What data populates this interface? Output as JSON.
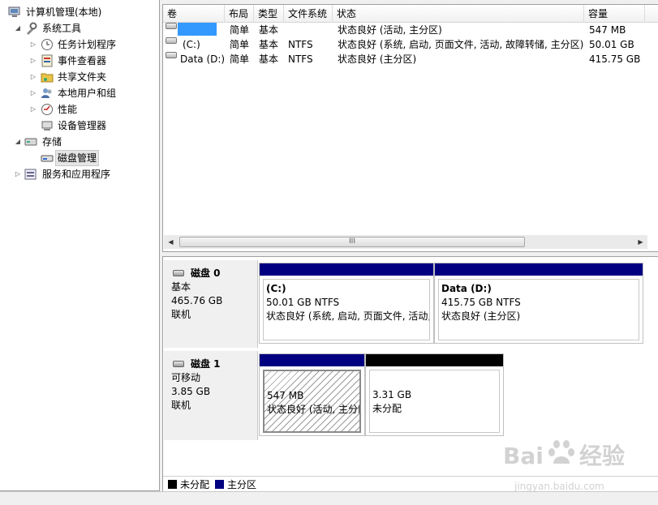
{
  "tree": {
    "items": [
      {
        "label": "计算机管理(本地)",
        "expander": "",
        "icon": "computer-management-icon"
      },
      {
        "label": "系统工具",
        "expander": "◢",
        "icon": "tools-icon"
      },
      {
        "label": "任务计划程序",
        "expander": "▷",
        "icon": "clock-icon"
      },
      {
        "label": "事件查看器",
        "expander": "▷",
        "icon": "event-viewer-icon"
      },
      {
        "label": "共享文件夹",
        "expander": "▷",
        "icon": "shared-folder-icon"
      },
      {
        "label": "本地用户和组",
        "expander": "▷",
        "icon": "users-icon"
      },
      {
        "label": "性能",
        "expander": "▷",
        "icon": "performance-icon"
      },
      {
        "label": "设备管理器",
        "expander": "",
        "icon": "device-manager-icon"
      },
      {
        "label": "存储",
        "expander": "◢",
        "icon": "storage-icon"
      },
      {
        "label": "磁盘管理",
        "expander": "",
        "icon": "disk-management-icon"
      },
      {
        "label": "服务和应用程序",
        "expander": "▷",
        "icon": "services-icon"
      }
    ]
  },
  "volumes": {
    "columns": [
      "卷",
      "布局",
      "类型",
      "文件系统",
      "状态",
      "容量"
    ],
    "rows": [
      {
        "name": "",
        "layout": "简单",
        "type": "基本",
        "fs": "",
        "status": "状态良好 (活动, 主分区)",
        "capacity": "547 MB"
      },
      {
        "name": "(C:)",
        "layout": "简单",
        "type": "基本",
        "fs": "NTFS",
        "status": "状态良好 (系统, 启动, 页面文件, 活动, 故障转储, 主分区)",
        "capacity": "50.01 GB"
      },
      {
        "name": "Data (D:)",
        "layout": "简单",
        "type": "基本",
        "fs": "NTFS",
        "status": "状态良好 (主分区)",
        "capacity": "415.75 GB"
      }
    ],
    "scroll_grip": "III"
  },
  "disks": [
    {
      "name": "磁盘 0",
      "type": "基本",
      "size": "465.76 GB",
      "state": "联机",
      "partitions": [
        {
          "title": "(C:)",
          "size": "50.01 GB NTFS",
          "status": "状态良好 (系统, 启动, 页面文件, 活动,"
        },
        {
          "title": "Data  (D:)",
          "size": "415.75 GB NTFS",
          "status": "状态良好 (主分区)"
        }
      ]
    },
    {
      "name": "磁盘 1",
      "type": "可移动",
      "size": "3.85 GB",
      "state": "联机",
      "partitions": [
        {
          "title": "",
          "size": "547 MB",
          "status": "状态良好 (活动, 主分区)"
        },
        {
          "title": "",
          "size": "3.31 GB",
          "status": "未分配"
        }
      ]
    }
  ],
  "legend": [
    {
      "label": "未分配",
      "color": "#000000"
    },
    {
      "label": "主分区",
      "color": "#000080"
    }
  ],
  "colors": {
    "primary_partition": "#000080",
    "unallocated": "#000000",
    "selection": "#3399ff"
  },
  "watermark": {
    "logo": "Baidu经验",
    "url": "jingyan.baidu.com"
  }
}
